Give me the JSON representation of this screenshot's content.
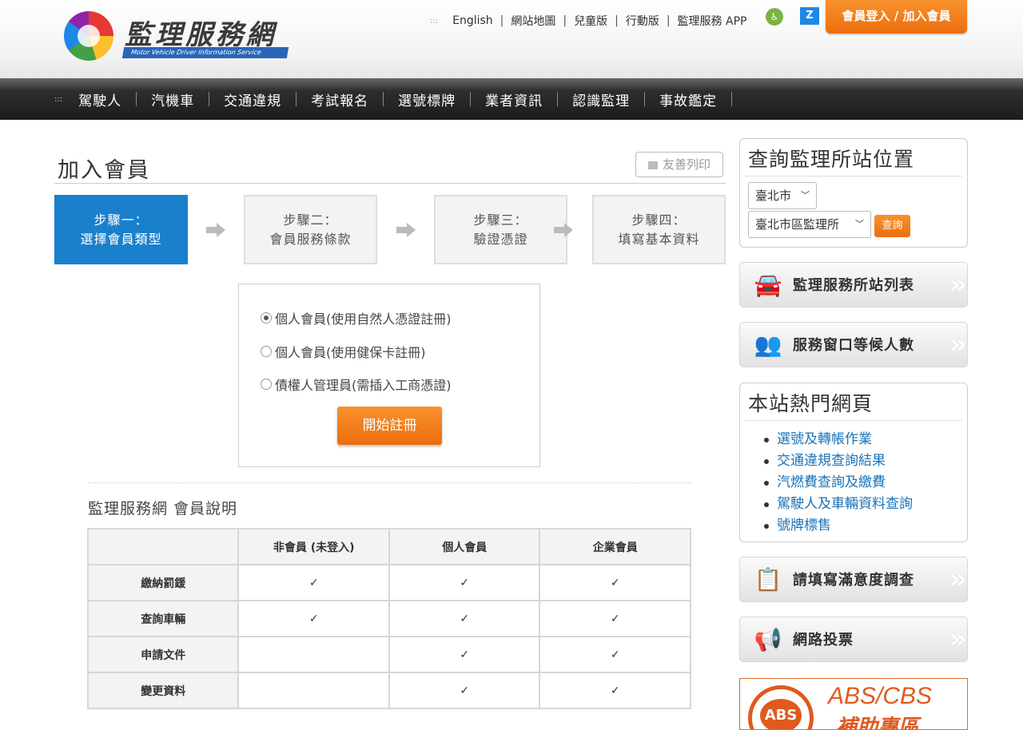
{
  "header": {
    "site_title": "監理服務網",
    "site_subtitle": "Motor Vehicle Driver Information Service",
    "top_links": [
      "English",
      "網站地圖",
      "兒童版",
      "行動版",
      "監理服務 APP"
    ],
    "member_button": "會員登入 / 加入會員"
  },
  "nav": {
    "items": [
      "駕駛人",
      "汽機車",
      "交通違規",
      "考試報名",
      "選號標牌",
      "業者資訊",
      "認識監理",
      "事故鑑定"
    ]
  },
  "main": {
    "page_title": "加入會員",
    "print_label": "友善列印",
    "steps": [
      {
        "line1": "步驟一：",
        "line2": "選擇會員類型",
        "active": true
      },
      {
        "line1": "步驟二：",
        "line2": "會員服務條款",
        "active": false
      },
      {
        "line1": "步驟三：",
        "line2": "驗證憑證",
        "active": false
      },
      {
        "line1": "步驟四：",
        "line2": "填寫基本資料",
        "active": false
      }
    ],
    "member_options": [
      {
        "label": "個人會員(使用自然人憑證註冊)",
        "checked": true
      },
      {
        "label": "個人會員(使用健保卡註冊)",
        "checked": false
      },
      {
        "label": "債權人管理員(需插入工商憑證)",
        "checked": false
      }
    ],
    "start_button": "開始註冊",
    "section_title": "監理服務網 會員說明",
    "table": {
      "headers": [
        "",
        "非會員 (未登入)",
        "個人會員",
        "企業會員"
      ],
      "rows": [
        [
          "繳納罰鍰",
          "✓",
          "✓",
          "✓"
        ],
        [
          "查詢車輛",
          "✓",
          "✓",
          "✓"
        ],
        [
          "申請文件",
          "",
          "✓",
          "✓"
        ],
        [
          "變更資料",
          "",
          "✓",
          "✓"
        ]
      ]
    }
  },
  "sidebar": {
    "location_title": "查詢監理所站位置",
    "city_select": "臺北市",
    "station_select": "臺北市區監理所",
    "query_button": "查詢",
    "banners": [
      "監理服務所站列表",
      "服務窗口等候人數",
      "請填寫滿意度調查",
      "網路投票"
    ],
    "hot_title": "本站熱門網頁",
    "hot_links": [
      "選號及轉帳作業",
      "交通違規查詢結果",
      "汽燃費查詢及繳費",
      "駕駛人及車輛資料查詢",
      "號牌標售"
    ],
    "ad": {
      "badge": "ABS",
      "line1": "ABS/CBS",
      "line2": "補助專區"
    }
  }
}
